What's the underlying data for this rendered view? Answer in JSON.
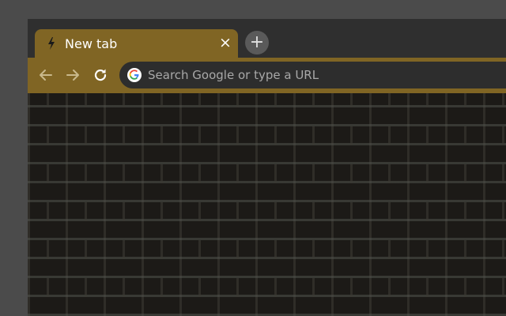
{
  "tab": {
    "title": "New tab",
    "close_glyph": "×",
    "favicon": "bolt-icon"
  },
  "new_tab_button": {
    "glyph": "+"
  },
  "toolbar": {
    "back_icon": "arrow-left-icon",
    "forward_icon": "arrow-right-icon",
    "reload_icon": "reload-icon"
  },
  "omnibox": {
    "placeholder": "Search Google or type a URL",
    "icon": "google-g-icon"
  },
  "theme": {
    "frame": "#2f2f2f",
    "accent": "#806524",
    "omnibox_bg": "#2d2d2d",
    "background_pattern": "dark brick wall"
  }
}
